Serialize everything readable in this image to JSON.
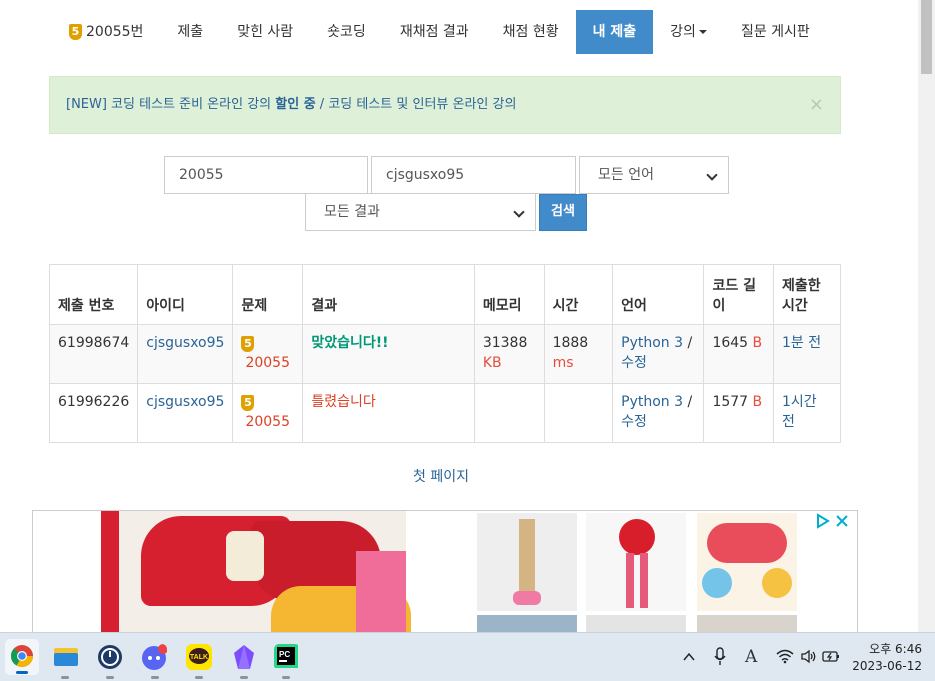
{
  "nav": {
    "problem_id": "20055번",
    "tier_badge": "5",
    "items": [
      "제출",
      "맞힌 사람",
      "숏코딩",
      "재채점 결과",
      "채점 현황",
      "내 제출",
      "강의",
      "질문 게시판"
    ]
  },
  "alert": {
    "prefix": "[NEW] 코딩 테스트 준비 온라인 강의 ",
    "bold": "할인 중",
    "sep": " / ",
    "suffix": "코딩 테스트 및 인터뷰 온라인 강의",
    "close": "×"
  },
  "search": {
    "problem": "20055",
    "user": "cjsgusxo95",
    "language": "모든 언어",
    "result": "모든 결과",
    "button": "검색"
  },
  "table": {
    "headers": [
      "제출 번호",
      "아이디",
      "문제",
      "결과",
      "메모리",
      "시간",
      "언어",
      "코드 길이",
      "제출한 시간"
    ],
    "rows": [
      {
        "id": "61998674",
        "user": "cjsgusxo95",
        "tier": "5",
        "problem": "20055",
        "result": "맞았습니다!!",
        "memory": "31388",
        "memory_unit": "KB",
        "time": "1888",
        "time_unit": "ms",
        "lang": "Python 3",
        "edit": "수정",
        "code_len": "1645",
        "code_unit": "B",
        "submitted": "1분 전"
      },
      {
        "id": "61996226",
        "user": "cjsgusxo95",
        "tier": "5",
        "problem": "20055",
        "result": "틀렸습니다",
        "memory": "",
        "memory_unit": "",
        "time": "",
        "time_unit": "",
        "lang": "Python 3",
        "edit": "수정",
        "code_len": "1577",
        "code_unit": "B",
        "submitted": "1시간 전"
      }
    ]
  },
  "pagination": {
    "first": "첫 페이지"
  },
  "taskbar": {
    "time": "오후 6:46",
    "date": "2023-06-12",
    "ime": "A"
  },
  "colors": {
    "primary": "#428bca",
    "accepted": "#009874",
    "wrong": "#dd4124",
    "tier_bronze": "#e0a100"
  }
}
